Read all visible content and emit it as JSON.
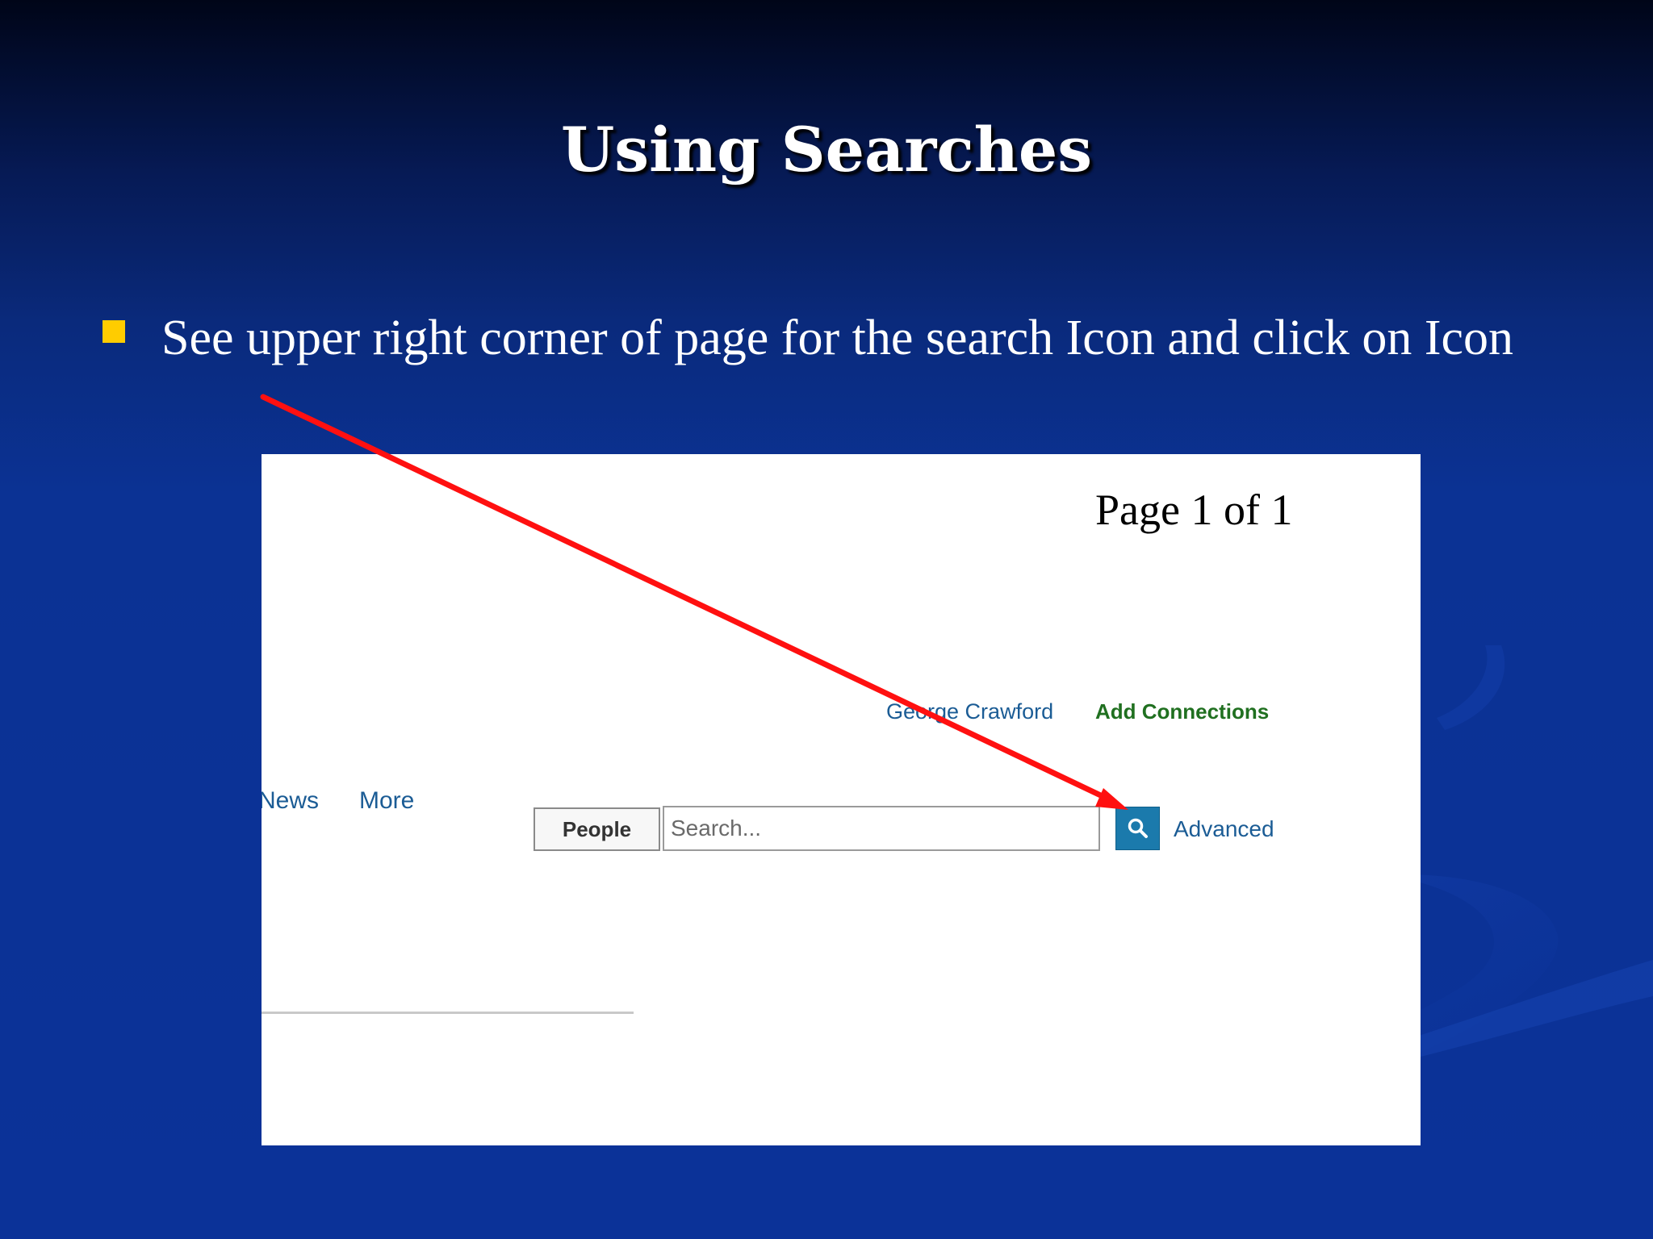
{
  "slide": {
    "title": "Using Searches",
    "bullet_text": "See upper right corner of page for the search Icon and click on Icon"
  },
  "screenshot": {
    "page_label": "Page 1 of 1",
    "header": {
      "user_name": "George Crawford",
      "add_connections": "Add Connections"
    },
    "nav": {
      "news": "News",
      "more": "More"
    },
    "search": {
      "scope_label": "People",
      "placeholder": "Search...",
      "advanced_label": "Advanced"
    }
  },
  "colors": {
    "bullet": "#ffcc00",
    "arrow": "#ff1010",
    "search_button": "#1b7aac",
    "link": "#1b5c95",
    "add_connections": "#207020"
  },
  "icons": {
    "search_button": "magnifier-icon",
    "bullet": "square-bullet-icon"
  }
}
